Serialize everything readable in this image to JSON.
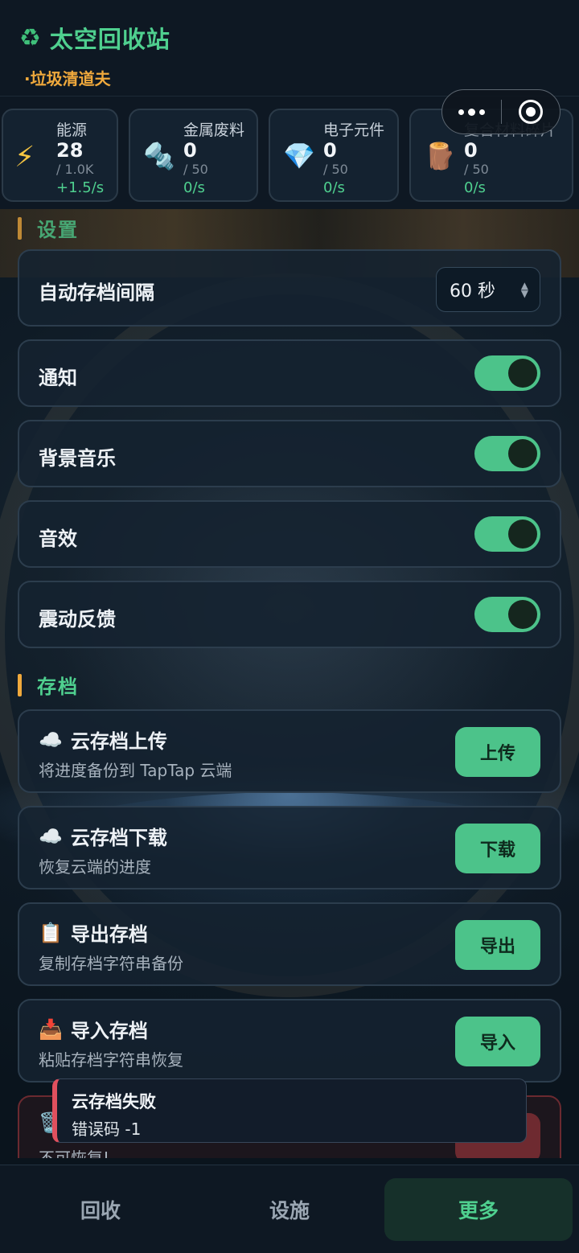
{
  "app": {
    "title": "太空回收站",
    "rank": "·垃圾清道夫",
    "icon": "recycle-icon"
  },
  "resources": [
    {
      "name": "能源",
      "value": "28",
      "cap": "/ 1.0K",
      "rate": "+1.5/s",
      "icon": "lightning-icon"
    },
    {
      "name": "金属废料",
      "value": "0",
      "cap": "/ 50",
      "rate": "0/s",
      "icon": "bolt-nut-icon"
    },
    {
      "name": "电子元件",
      "value": "0",
      "cap": "/ 50",
      "rate": "0/s",
      "icon": "gem-icon"
    },
    {
      "name": "复合材料碎片",
      "value": "0",
      "cap": "/ 50",
      "rate": "0/s",
      "icon": "wood-log-icon"
    }
  ],
  "settings": {
    "section_title": "设置",
    "autosave": {
      "label": "自动存档间隔",
      "value": "60 秒"
    },
    "toggles": [
      {
        "label": "通知",
        "on": true
      },
      {
        "label": "背景音乐",
        "on": true
      },
      {
        "label": "音效",
        "on": true
      },
      {
        "label": "震动反馈",
        "on": true
      }
    ]
  },
  "saves": {
    "section_title": "存档",
    "items": [
      {
        "icon": "☁️",
        "title": "云存档上传",
        "desc": "将进度备份到 TapTap 云端",
        "button": "上传"
      },
      {
        "icon": "☁️",
        "title": "云存档下载",
        "desc": "恢复云端的进度",
        "button": "下载"
      },
      {
        "icon": "📋",
        "title": "导出存档",
        "desc": "复制存档字符串备份",
        "button": "导出"
      },
      {
        "icon": "📥",
        "title": "导入存档",
        "desc": "粘贴存档字符串恢复",
        "button": "导入"
      }
    ],
    "danger": {
      "icon": "🗑️",
      "desc": "不可恢复!"
    }
  },
  "toast": {
    "title": "云存档失败",
    "detail": "错误码 -1"
  },
  "nav": {
    "items": [
      "回收",
      "设施",
      "更多"
    ],
    "active": "更多"
  },
  "colors": {
    "accent": "#4fd08f",
    "rank": "#f0a93c",
    "danger": "#e0505e"
  }
}
